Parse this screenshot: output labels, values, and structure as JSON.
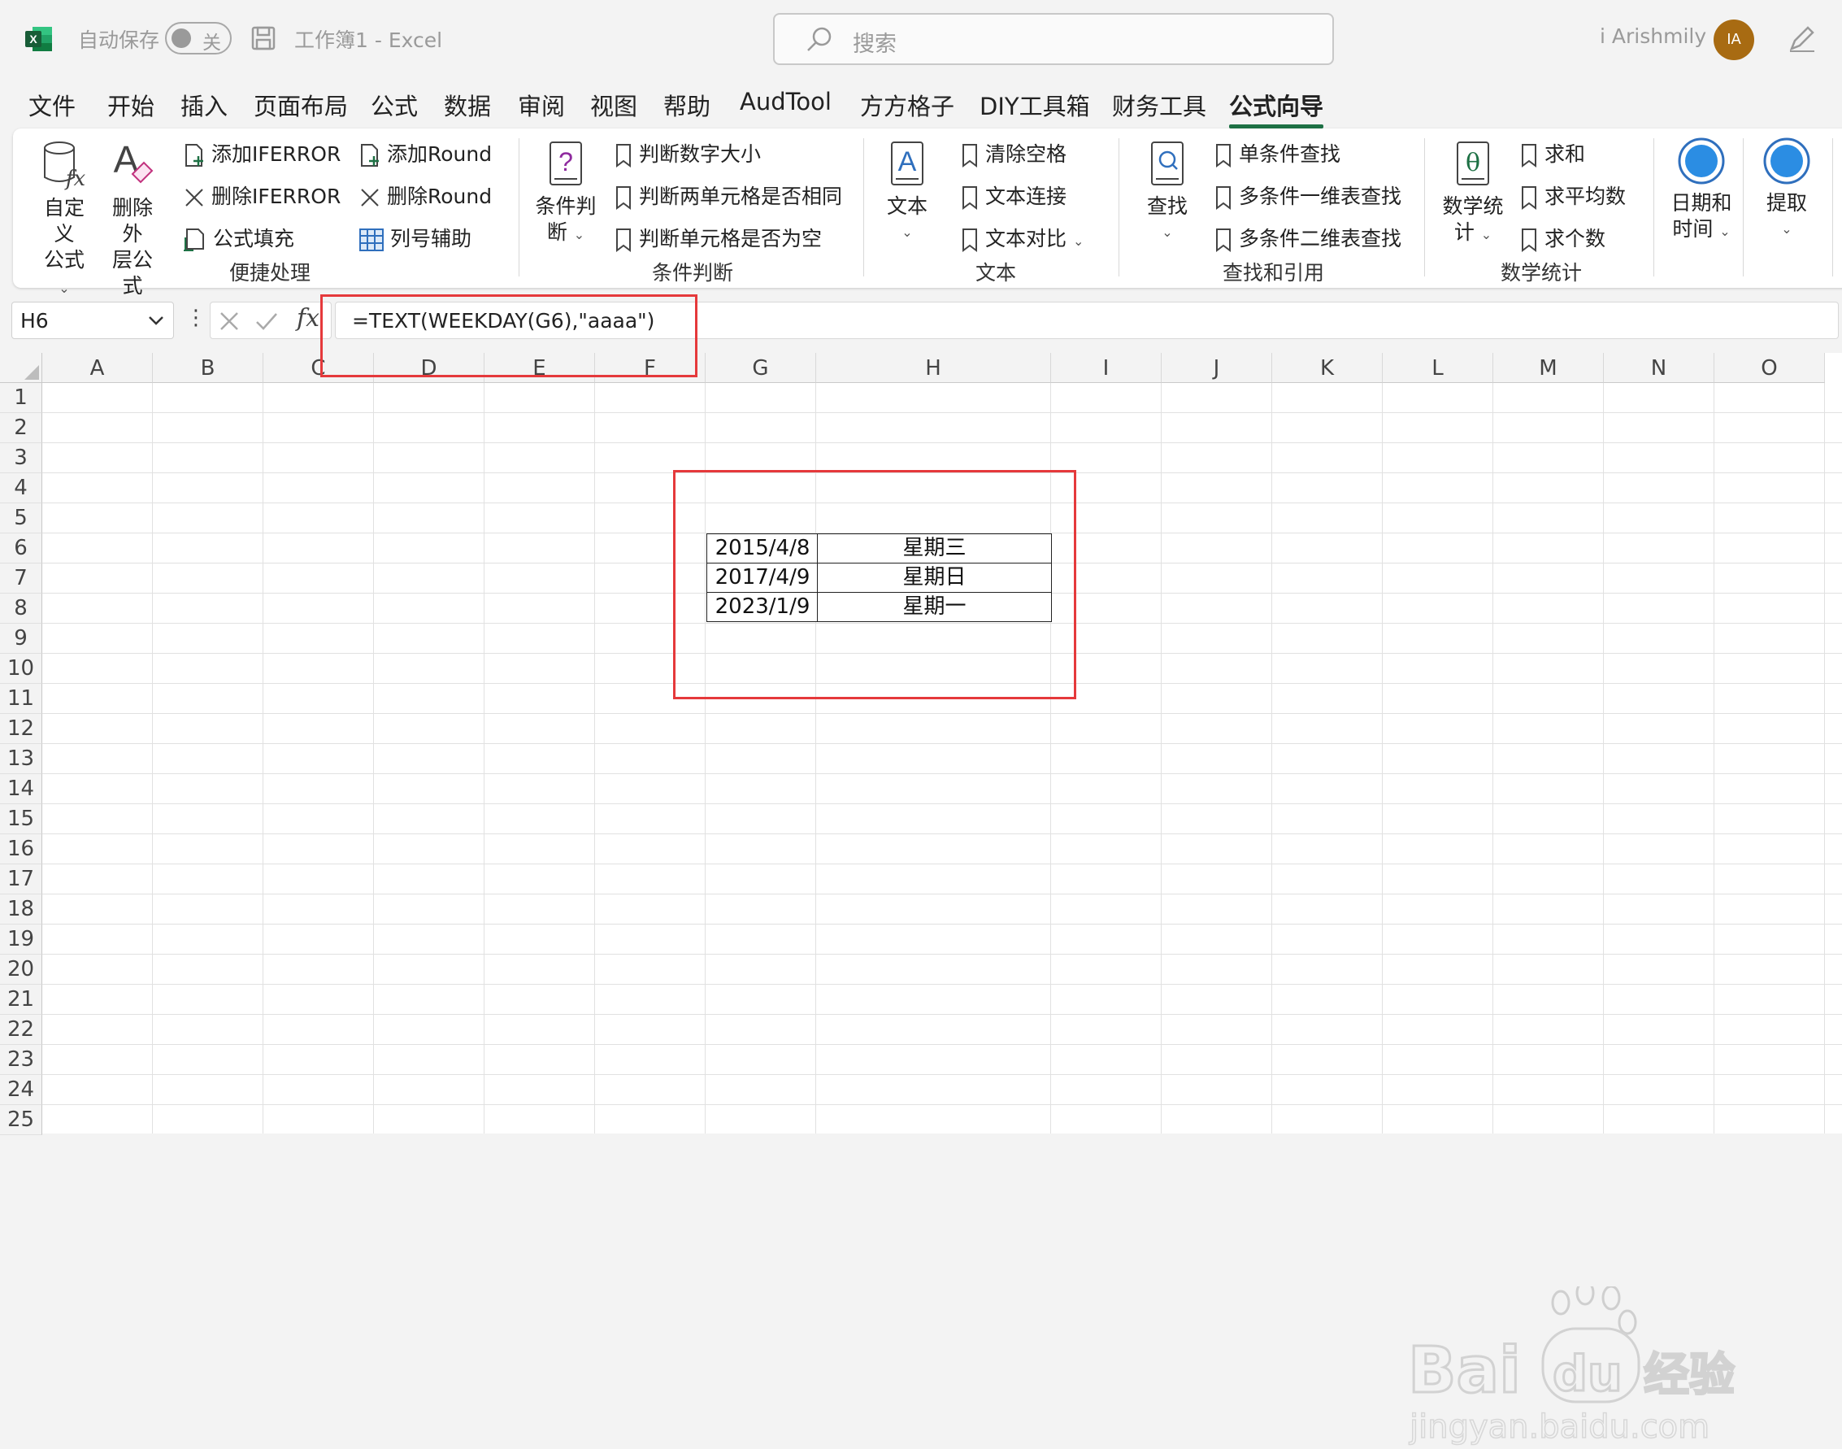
{
  "title_bar": {
    "autosave_label": "自动保存",
    "autosave_state": "关",
    "document_title": "工作簿1  -  Excel",
    "search_placeholder": "搜索",
    "user_name": "i Arishmily",
    "avatar_initials": "IA"
  },
  "menu": {
    "tabs": [
      "文件",
      "开始",
      "插入",
      "页面布局",
      "公式",
      "数据",
      "审阅",
      "视图",
      "帮助",
      "AudTool",
      "方方格子",
      "DIY工具箱",
      "财务工具",
      "公式向导"
    ],
    "active_tab": "公式向导"
  },
  "ribbon": {
    "groups": {
      "convenience": {
        "label": "便捷处理",
        "custom_formula": [
          "自定义",
          "公式"
        ],
        "remove_outer": [
          "删除外",
          "层公式"
        ],
        "add_iferror": "添加IFERROR",
        "delete_iferror": "删除IFERROR",
        "formula_fill": "公式填充",
        "add_round": "添加Round",
        "delete_round": "删除Round",
        "column_helper": "列号辅助"
      },
      "condition": {
        "label": "条件判断",
        "big_button": [
          "条件判",
          "断"
        ],
        "items": [
          "判断数字大小",
          "判断两单元格是否相同",
          "判断单元格是否为空"
        ]
      },
      "text": {
        "label": "文本",
        "big_button": "文本",
        "items": [
          "清除空格",
          "文本连接",
          "文本对比"
        ]
      },
      "lookup": {
        "label": "查找和引用",
        "big_button": "查找",
        "items": [
          "单条件查找",
          "多条件一维表查找",
          "多条件二维表查找"
        ]
      },
      "math": {
        "label": "数学统计",
        "big_button": [
          "数学统",
          "计"
        ],
        "items": [
          "求和",
          "求平均数",
          "求个数"
        ]
      },
      "datetime": {
        "big_button": [
          "日期和",
          "时间"
        ]
      },
      "extract": {
        "big_button": "提取"
      }
    }
  },
  "formula_bar": {
    "name_box": "H6",
    "formula": "=TEXT(WEEKDAY(G6),\"aaaa\")"
  },
  "sheet": {
    "columns": [
      "A",
      "B",
      "C",
      "D",
      "E",
      "F",
      "G",
      "H",
      "I",
      "J",
      "K",
      "L",
      "M",
      "N",
      "O"
    ],
    "rows": [
      "1",
      "2",
      "3",
      "4",
      "5",
      "6",
      "7",
      "8",
      "9",
      "10",
      "11",
      "12",
      "13",
      "14",
      "15",
      "16",
      "17",
      "18",
      "19",
      "20",
      "21",
      "22",
      "23",
      "24",
      "25"
    ],
    "table": [
      {
        "row": "6",
        "date": "2015/4/8",
        "weekday": "星期三"
      },
      {
        "row": "7",
        "date": "2017/4/9",
        "weekday": "星期日"
      },
      {
        "row": "8",
        "date": "2023/1/9",
        "weekday": "星期一"
      }
    ]
  },
  "watermark": {
    "brand": "Baidu经验",
    "url": "jingyan.baidu.com"
  },
  "colors": {
    "excel_green": "#1e7145",
    "highlight_red": "#e5393b",
    "avatar": "#a86b12",
    "ribbon_blue": "#2f6fbd"
  }
}
